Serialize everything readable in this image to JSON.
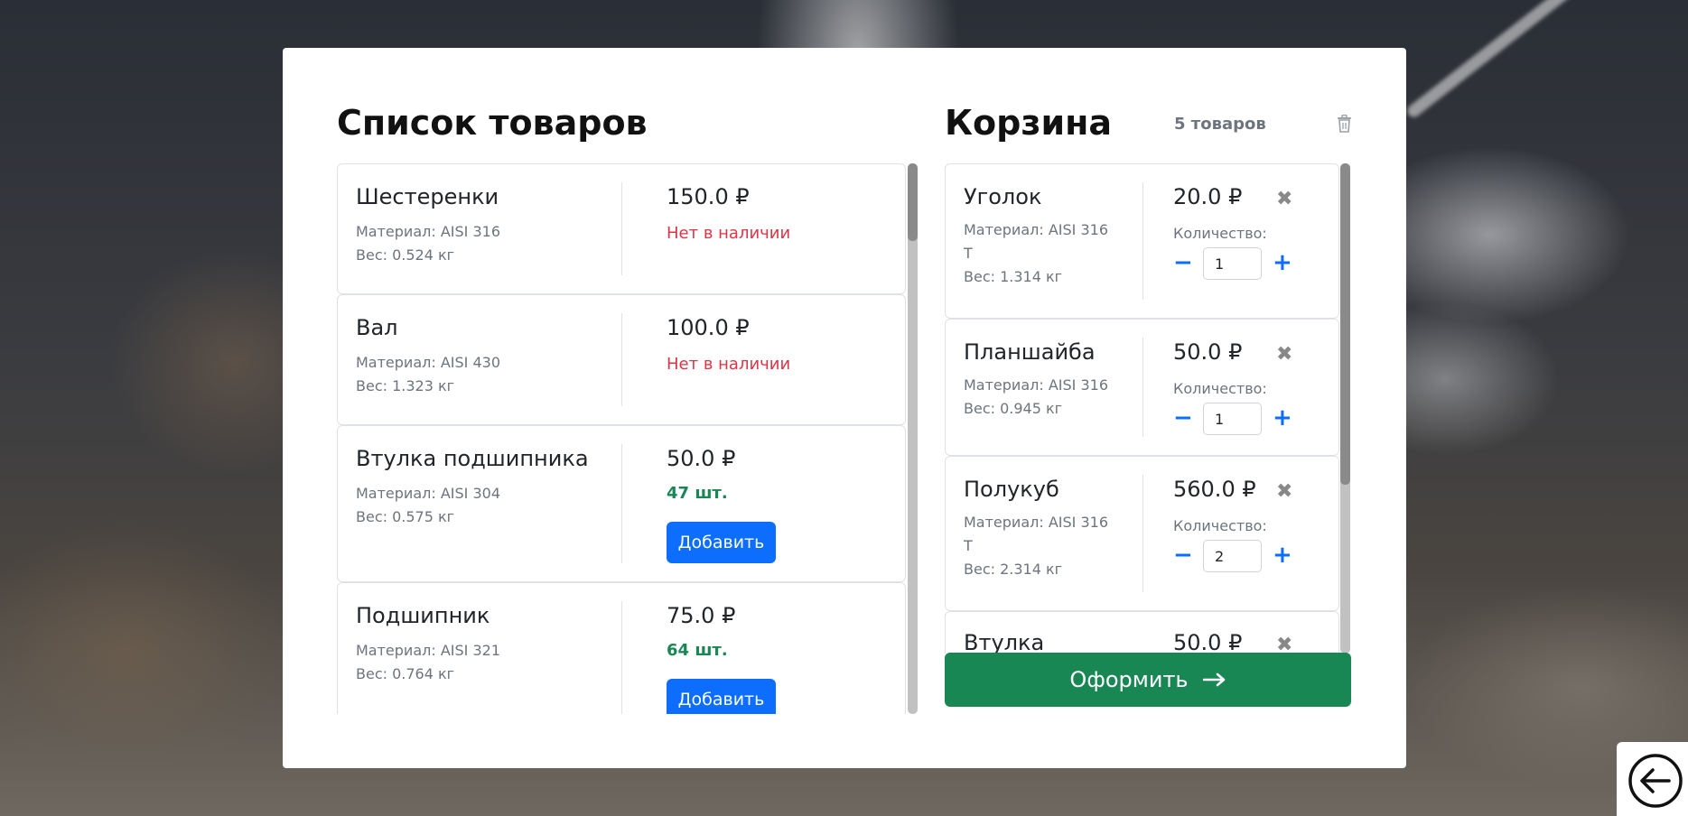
{
  "catalog": {
    "title": "Список товаров",
    "add_label": "Добавить",
    "items": [
      {
        "name": "Шестеренки",
        "material": "Материал: AISI 316",
        "weight": "Вес: 0.524 кг",
        "price": "150.0 ₽",
        "stock": "Нет в наличии"
      },
      {
        "name": "Вал",
        "material": "Материал: AISI 430",
        "weight": "Вес: 1.323 кг",
        "price": "100.0 ₽",
        "stock": "Нет в наличии"
      },
      {
        "name": "Втулка подшипника",
        "material": "Материал: AISI 304",
        "weight": "Вес: 0.575 кг",
        "price": "50.0 ₽",
        "stock": "47 шт."
      },
      {
        "name": "Подшипник",
        "material": "Материал: AISI 321",
        "weight": "Вес: 0.764 кг",
        "price": "75.0 ₽",
        "stock": "64 шт."
      }
    ]
  },
  "cart": {
    "title": "Корзина",
    "count": "5 товаров",
    "qty_label": "Количество:",
    "checkout_label": "Оформить",
    "items": [
      {
        "name": "Уголок",
        "material": "Материал: AISI 316 T",
        "weight": "Вес: 1.314 кг",
        "price": "20.0 ₽",
        "qty": "1"
      },
      {
        "name": "Планшайба",
        "material": "Материал: AISI 316",
        "weight": "Вес: 0.945 кг",
        "price": "50.0 ₽",
        "qty": "1"
      },
      {
        "name": "Полукуб",
        "material": "Материал: AISI 316 T",
        "weight": "Вес: 2.314 кг",
        "price": "560.0 ₽",
        "qty": "2"
      },
      {
        "name": "Втулка",
        "price": "50.0 ₽"
      }
    ]
  },
  "colors": {
    "primary": "#0d6efd",
    "success": "#198754",
    "danger": "#dc3545",
    "muted": "#6c757d"
  },
  "icons": {
    "trash": "trash-icon",
    "remove": "close-icon",
    "minus": "minus-icon",
    "plus": "plus-icon",
    "checkout_arrow": "arrow-right-icon",
    "back": "arrow-left-circle-icon"
  }
}
